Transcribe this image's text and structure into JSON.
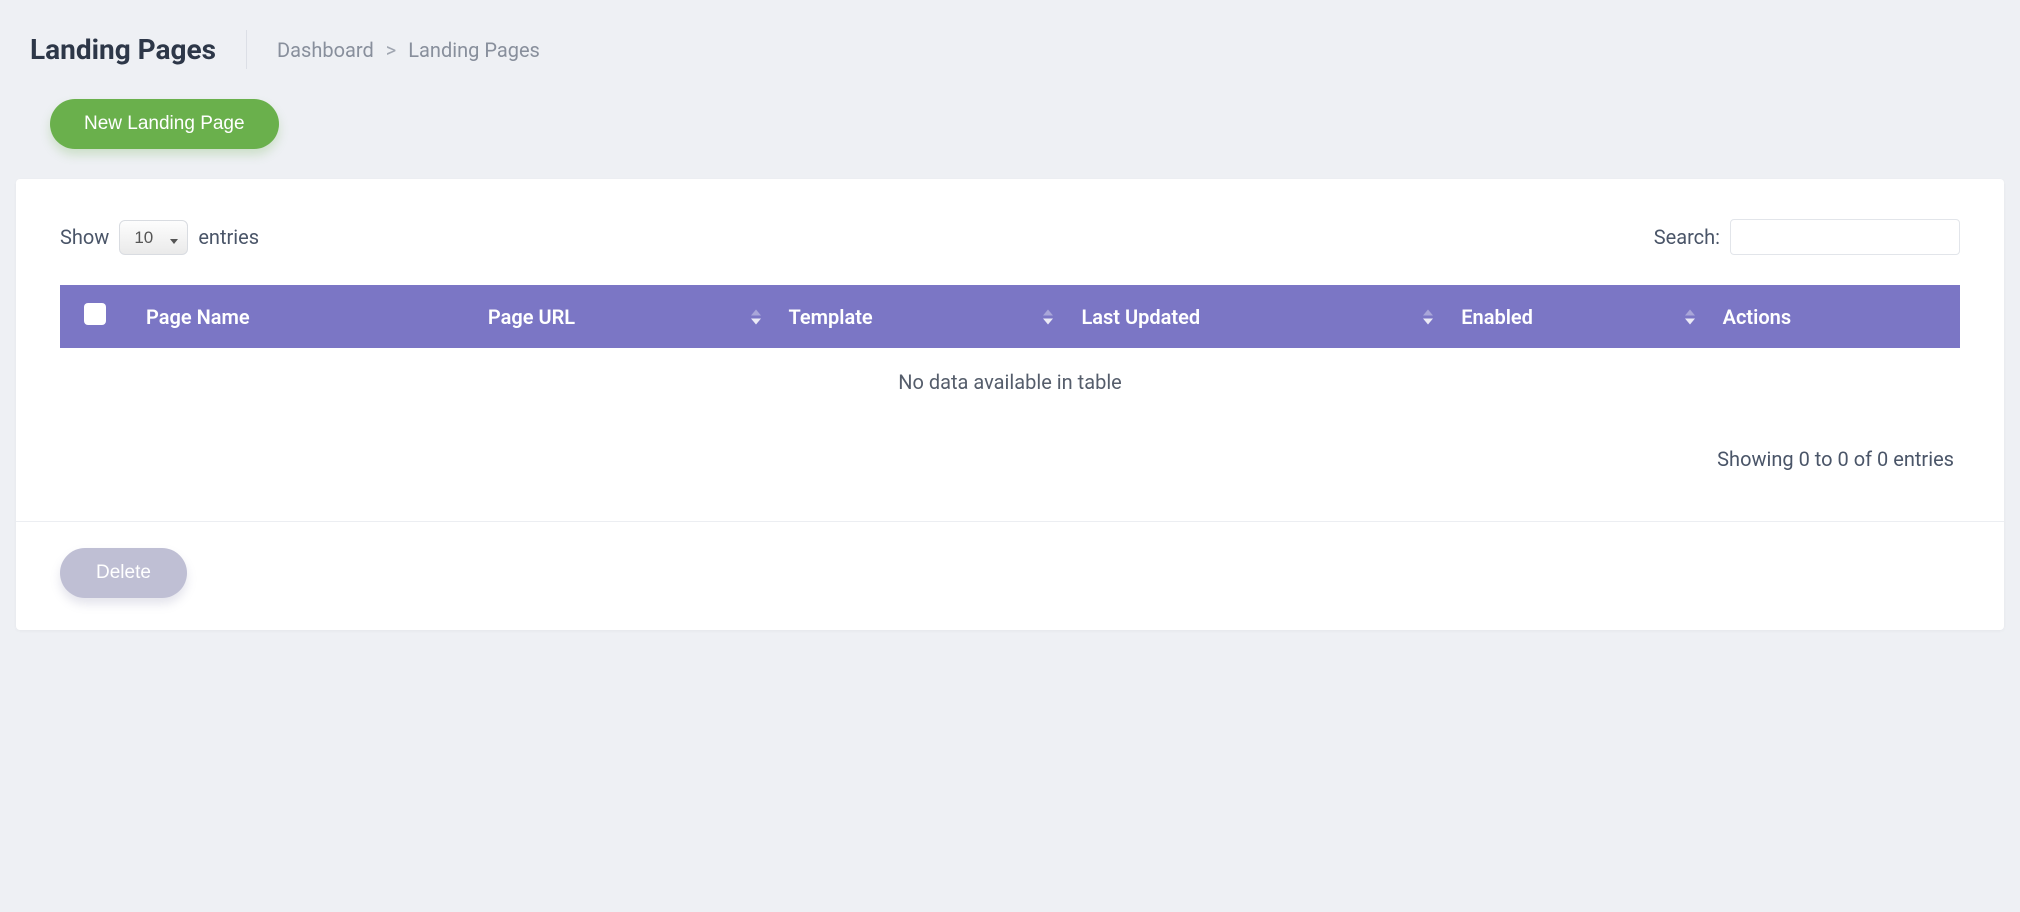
{
  "header": {
    "title": "Landing Pages",
    "breadcrumb": {
      "item1": "Dashboard",
      "sep": ">",
      "item2": "Landing Pages"
    },
    "new_button_label": "New Landing Page"
  },
  "table": {
    "length_prefix": "Show",
    "length_value": "10",
    "length_suffix": "entries",
    "search_label": "Search:",
    "columns": {
      "page_name": "Page Name",
      "page_url": "Page URL",
      "template": "Template",
      "last_updated": "Last Updated",
      "enabled": "Enabled",
      "actions": "Actions"
    },
    "empty_message": "No data available in table",
    "info_text": "Showing 0 to 0 of 0 entries"
  },
  "footer": {
    "delete_label": "Delete"
  }
}
